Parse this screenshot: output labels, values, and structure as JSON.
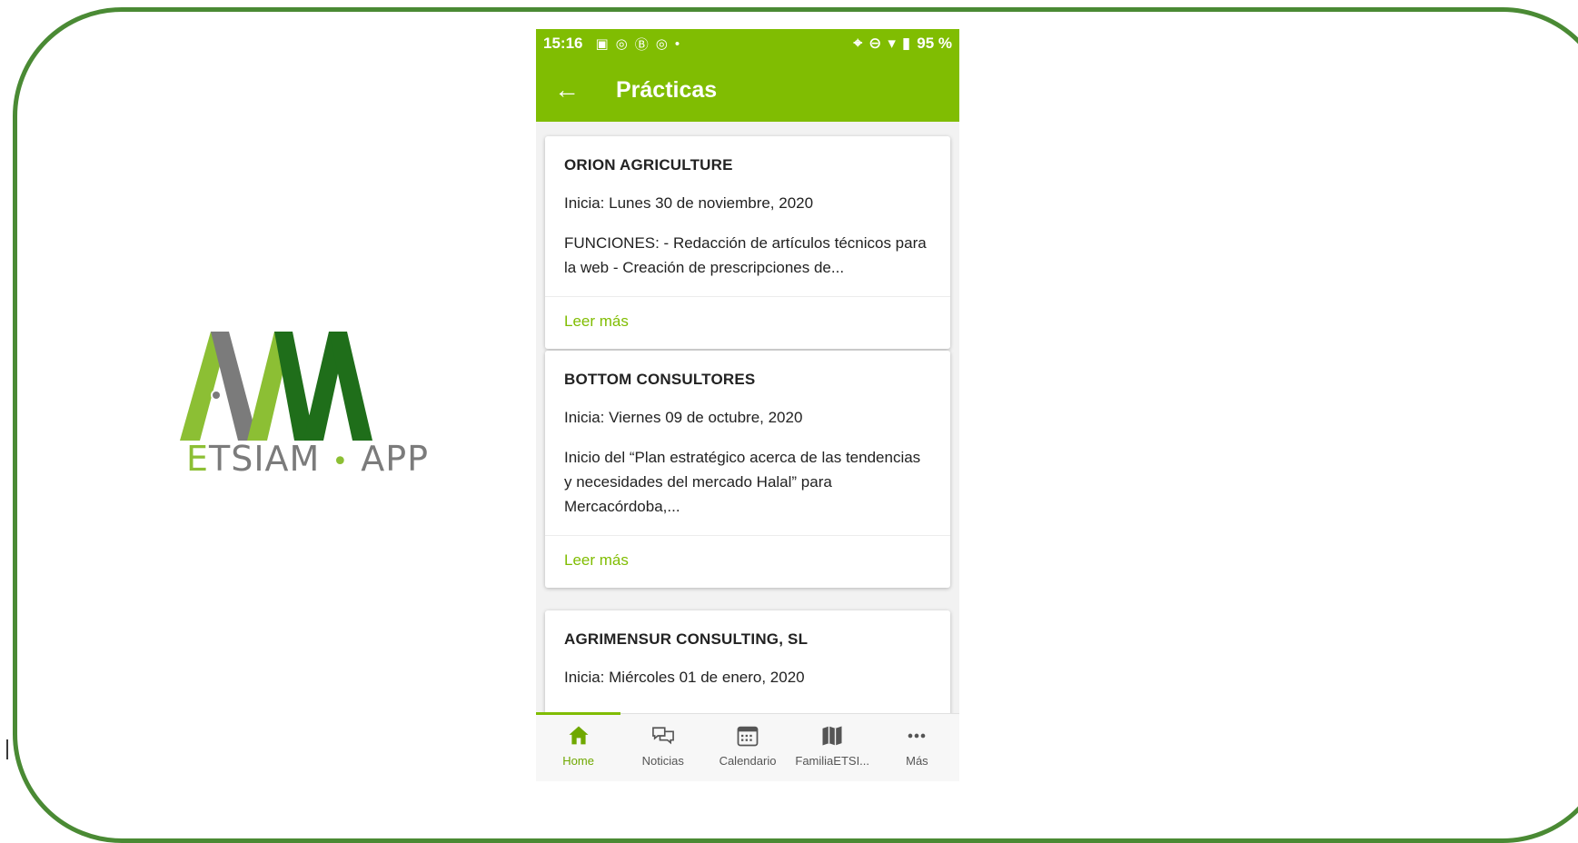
{
  "logo": {
    "letter_e": "E",
    "rest": "TSIAM",
    "dot": "•",
    "suffix": "APP"
  },
  "status_bar": {
    "time": "15:16",
    "battery": "95 %"
  },
  "app_bar": {
    "title": "Prácticas"
  },
  "cards": [
    {
      "company": "ORION AGRICULTURE",
      "date": "Inicia: Lunes 30 de noviembre, 2020",
      "description": "FUNCIONES: - Redacción de artículos técnicos para la web - Creación de prescripciones de...",
      "more": "Leer más"
    },
    {
      "company": "BOTTOM CONSULTORES",
      "date": "Inicia: Viernes 09 de octubre, 2020",
      "description": "Inicio del “Plan estratégico acerca de las tendencias y necesidades del mercado Halal” para Mercacórdoba,...",
      "more": "Leer más"
    },
    {
      "company": "AGRIMENSUR CONSULTING, SL",
      "date": "Inicia: Miércoles 01 de enero, 2020"
    }
  ],
  "tabs": [
    {
      "label": "Home",
      "icon": "home-icon"
    },
    {
      "label": "Noticias",
      "icon": "chat-icon"
    },
    {
      "label": "Calendario",
      "icon": "calendar-icon"
    },
    {
      "label": "FamiliaETSI...",
      "icon": "map-icon"
    },
    {
      "label": "Más",
      "icon": "more-icon"
    }
  ],
  "colors": {
    "primary": "#80bd02",
    "frame": "#4a8a34",
    "logo_dark_green": "#1f6e1a",
    "logo_light_green": "#8cbf34",
    "logo_gray": "#7b7b7b"
  }
}
